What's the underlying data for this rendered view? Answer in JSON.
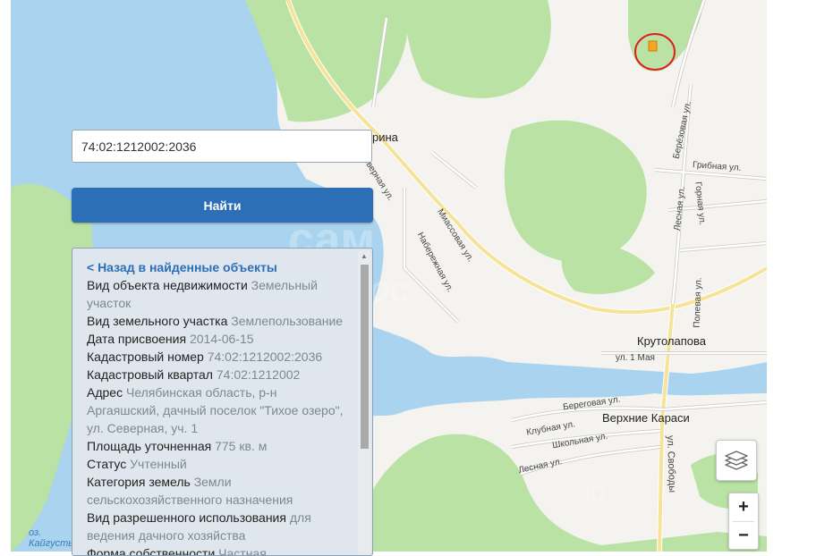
{
  "search": {
    "value": "74:02:1212002:2036",
    "button_label": "Найти"
  },
  "info": {
    "back_link": "< Назад в найденные объекты",
    "rows": [
      {
        "key": "Вид объекта недвижимости",
        "value": "Земельный участок"
      },
      {
        "key": "Вид земельного участка",
        "value": "Землепользование"
      },
      {
        "key": "Дата присвоения",
        "value": "2014-06-15"
      },
      {
        "key": "Кадастровый номер",
        "value": "74:02:1212002:2036"
      },
      {
        "key": "Кадастровый квартал",
        "value": "74:02:1212002"
      },
      {
        "key": "Адрес",
        "value": "Челябинская область, р-н Аргаяшский, дачный поселок \"Тихое озеро\", ул. Северная, уч. 1"
      },
      {
        "key": "Площадь уточненная",
        "value": "775 кв. м"
      },
      {
        "key": "Статус",
        "value": "Учтенный"
      },
      {
        "key": "Категория земель",
        "value": "Земли сельскохозяйственного назначения"
      },
      {
        "key": "Вид разрешенного использования",
        "value": "для ведения дачного хозяйства"
      },
      {
        "key": "Форма собственности",
        "value": "Частная"
      }
    ]
  },
  "map": {
    "towns": {
      "kaysarina": "йсарина",
      "krutolapova": "Крутолапова",
      "verkhnie_karasi": "Верхние Караси"
    },
    "streets": {
      "severnaya": "Северная ул.",
      "miassovaya": "Миассовая ул.",
      "naberezhnaya": "Набережная ул.",
      "berezovaya": "Берёзовая ул.",
      "gribnaya": "Грибная ул.",
      "lesnaya_north": "Лесная ул.",
      "gornaya": "Горная ул.",
      "polevaya": "Полевая ул.",
      "pervogo_maya": "ул. 1 Мая",
      "beregovaya": "Береговая ул.",
      "klubnaya": "Клубная ул.",
      "shkolnaya": "Школьная ул.",
      "lesnaya_south": "Лесная ул.",
      "svobody": "ул. Свободы"
    },
    "lake": {
      "prefix": "оз.",
      "name": "Кайгусты"
    },
    "colors": {
      "water": "#a9d3ee",
      "forest": "#b9e2a4",
      "land": "#f4f3ef",
      "road_major": "#f6e39a",
      "marker": "#e31b1b"
    }
  },
  "watermark": {
    "line1": "сам",
    "line2": "плюс",
    "line3": "ID"
  },
  "controls": {
    "layers_icon": "layers-icon",
    "zoom_in": "+",
    "zoom_out": "−"
  }
}
